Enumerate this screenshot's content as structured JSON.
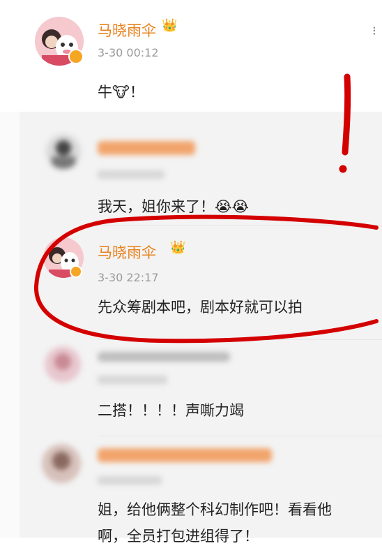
{
  "top_comment": {
    "username": "马晓雨伞",
    "crown_icon": "👑",
    "time": "3-30 00:12",
    "text": "牛🐮！"
  },
  "replies": [
    {
      "username": "",
      "time": "",
      "text": "我天，姐你来了！😭😭"
    },
    {
      "username": "马晓雨伞",
      "crown_icon": "👑",
      "time": "3-30 22:17",
      "text": "先众筹剧本吧，剧本好就可以拍"
    },
    {
      "username": "",
      "time": "",
      "text": "二搭！！！！声嘶力竭"
    },
    {
      "username": "",
      "time": "",
      "text_line1": "姐，给他俩整个科幻制作吧！看看他",
      "text_line2": "啊，全员打包进组得了！"
    }
  ],
  "colors": {
    "username": "#e8801c",
    "annotation_red": "#d40000",
    "verified_badge": "#f5a623"
  },
  "icons": [
    "crown-icon",
    "verified-badge-icon",
    "cow-emoji-icon",
    "crying-emoji-icon"
  ]
}
